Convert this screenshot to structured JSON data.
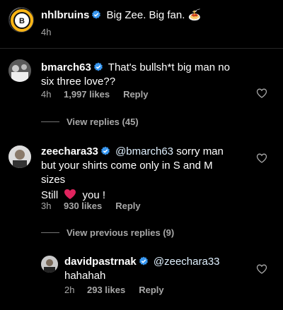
{
  "post": {
    "username": "nhlbruins",
    "caption": "Big Zee. Big fan.",
    "caption_emoji": "🍝",
    "time": "4h"
  },
  "comments": [
    {
      "username": "bmarch63",
      "text_line1": "That's bullsh*t big man no",
      "text_line2": "six three love??",
      "time": "4h",
      "likes": "1,997 likes",
      "reply": "Reply",
      "view_replies": "View replies (45)"
    },
    {
      "username": "zeechara33",
      "mention": "@bmarch63",
      "text_line1": "sorry man",
      "text_line2": "but your shirts come only in S and M",
      "text_line3": "sizes",
      "text_line4_a": "Still",
      "text_line4_b": "you !",
      "time": "3h",
      "likes": "930 likes",
      "reply": "Reply",
      "view_previous": "View previous replies (9)"
    },
    {
      "username": "davidpastrnak",
      "mention": "@zeechara33",
      "text_line2": "hahahah",
      "time": "2h",
      "likes": "293 likes",
      "reply": "Reply"
    }
  ],
  "icons": {
    "verified": "verified-badge-icon",
    "heart": "heart-outline-icon",
    "red_heart": "red-heart-emoji"
  },
  "colors": {
    "verified_blue": "#3897f0",
    "secondary_text": "#a8a8a8",
    "red_heart": "#e0245e",
    "bruins_gold": "#fcb514"
  }
}
